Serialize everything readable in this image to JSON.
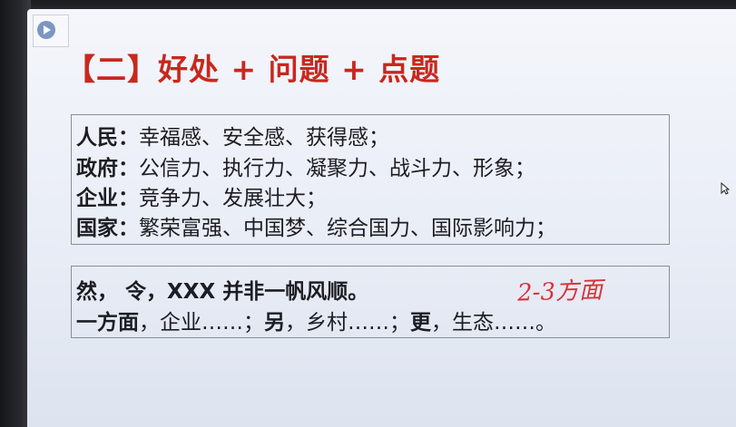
{
  "slide": {
    "title": "【二】好处 + 问题 + 点题",
    "box1": {
      "lines": [
        {
          "label": "人民：",
          "text": "幸福感、安全感、获得感；"
        },
        {
          "label": "政府：",
          "text": "公信力、执行力、凝聚力、战斗力、形象；"
        },
        {
          "label": "企业：",
          "text": "竞争力、发展壮大；"
        },
        {
          "label": "国家：",
          "text": "繁荣富强、中国梦、综合国力、国际影响力；"
        }
      ]
    },
    "box2": {
      "line1": "然， 令，XXX 并非一帆风顺。",
      "line2": {
        "p1": "一方面",
        "p2": "，企业……；",
        "p3": "另",
        "p4": "，乡村……；",
        "p5": "更",
        "p6": "，生态……。"
      },
      "handwritten_note": "2-3方面"
    }
  },
  "colors": {
    "title_red": "#c8281e",
    "text": "#1c1d22",
    "handwriting_red": "#d4333b",
    "box_border": "#8a8e96"
  },
  "icons": {
    "logo": "play-icon",
    "cursor": "mouse-cursor-icon"
  }
}
